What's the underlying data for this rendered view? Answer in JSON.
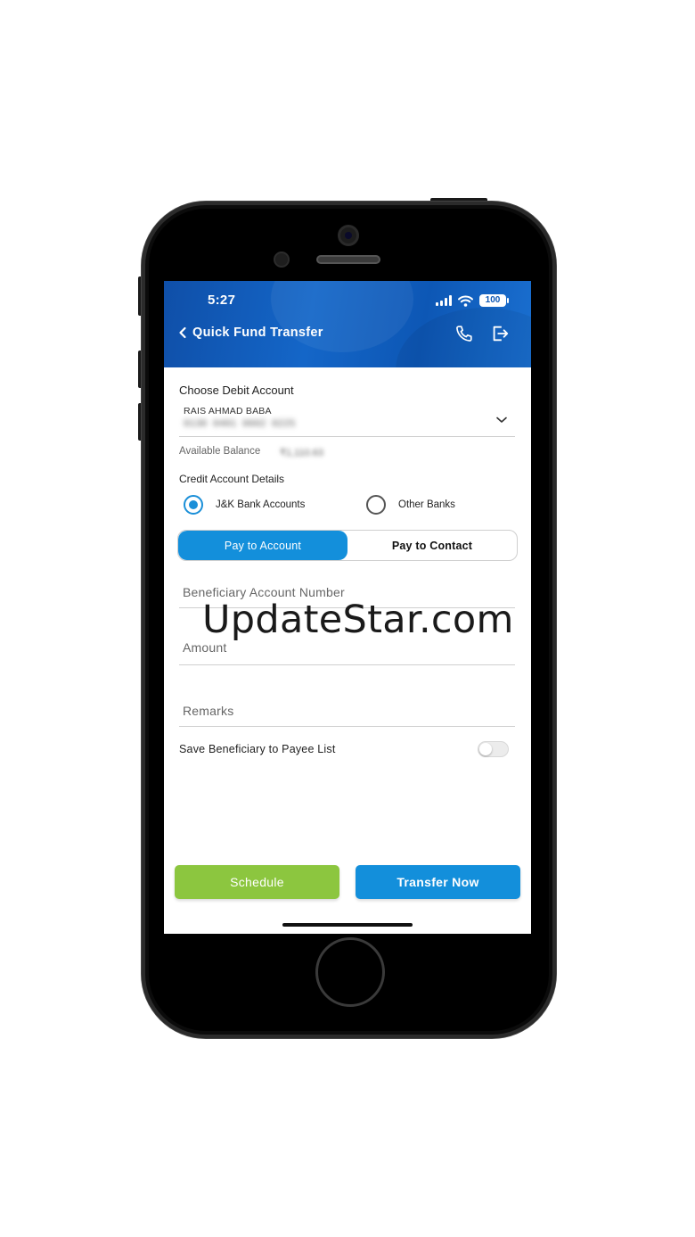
{
  "status_bar": {
    "time": "5:27",
    "battery": "100",
    "icons": [
      "signal-icon",
      "wifi-icon",
      "battery-icon"
    ]
  },
  "header": {
    "title": "Quick Fund Transfer",
    "back_icon": "chevron-left-icon",
    "actions": [
      "phone-icon",
      "logout-icon"
    ],
    "colors": {
      "primary": "#0f4fa8",
      "accent": "#1a6fd0"
    }
  },
  "debit": {
    "title": "Choose Debit Account",
    "holder": "RAIS AHMAD BABA",
    "account_masked": "0130 0401 0602 0225",
    "balance_label": "Available Balance",
    "balance_value": "₹1,110.63"
  },
  "credit": {
    "title": "Credit Account Details",
    "options": [
      {
        "label": "J&K Bank Accounts",
        "selected": true
      },
      {
        "label": "Other Banks",
        "selected": false
      }
    ]
  },
  "segment": {
    "active": "Pay to Account",
    "inactive": "Pay to Contact"
  },
  "form": {
    "beneficiary_placeholder": "Beneficiary Account Number",
    "amount_placeholder": "Amount",
    "remarks_placeholder": "Remarks"
  },
  "watermark": "UpdateStar.com",
  "save_beneficiary": {
    "label": "Save Beneficiary to Payee List",
    "enabled": false
  },
  "actions": {
    "schedule": "Schedule",
    "transfer": "Transfer Now",
    "colors": {
      "schedule": "#8cc63f",
      "transfer": "#138fdb"
    }
  }
}
